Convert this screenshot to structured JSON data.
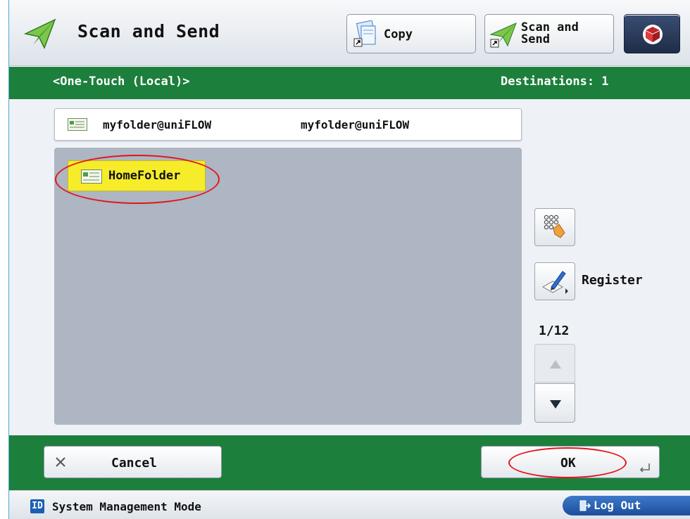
{
  "header": {
    "title": "Scan and Send",
    "copy_label": "Copy",
    "scan_send_label_line1": "Scan and",
    "scan_send_label_line2": "Send"
  },
  "subheader": {
    "group": "<One-Touch (Local)>",
    "destinations": "Destinations: 1"
  },
  "selected_destination": {
    "name": "myfolder@uniFLOW",
    "address": "myfolder@uniFLOW"
  },
  "list": {
    "items": [
      {
        "label": "HomeFolder",
        "selected": true
      }
    ]
  },
  "sidebar": {
    "register_label": "Register",
    "page_indicator": "1/12"
  },
  "footer": {
    "cancel_label": "Cancel",
    "ok_label": "OK"
  },
  "status": {
    "id_badge": "ID",
    "mode": "System Management Mode",
    "logout_label": "Log Out"
  },
  "colors": {
    "green_bar": "#1c7f3c",
    "selected_item": "#f6ec2a",
    "annotation": "#e2141b"
  }
}
